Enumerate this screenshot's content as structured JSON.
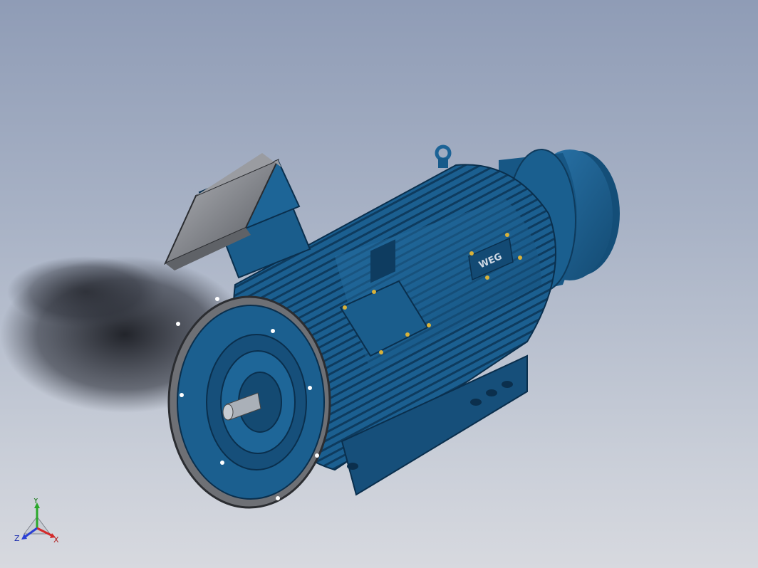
{
  "view": {
    "model_name": "induction-motor",
    "nameplate_logo": "WEG"
  },
  "triad": {
    "x_label": "X",
    "y_label": "Y",
    "z_label": "Z",
    "x_color": "#d42a2a",
    "y_color": "#2aa82a",
    "z_color": "#2a3fd4"
  },
  "colors": {
    "motor_blue": "#1a5d8c",
    "motor_dark": "#0f3f63",
    "motor_light": "#2f78ab",
    "cover_gray": "#7d7f84",
    "bolt_gold": "#d8b23a"
  }
}
